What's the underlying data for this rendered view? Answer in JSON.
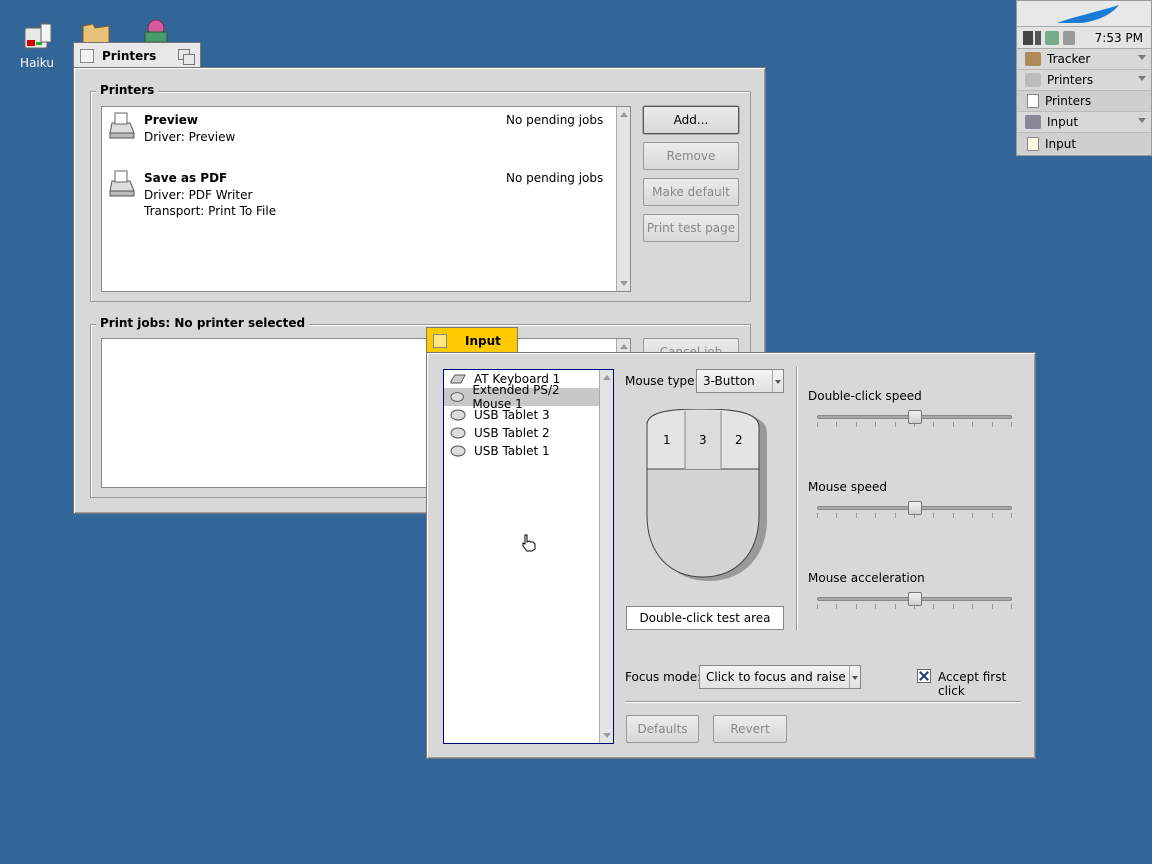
{
  "desktop": {
    "icons": [
      {
        "label": "Haiku"
      }
    ]
  },
  "deskbar": {
    "clock": "7:53 PM",
    "items": [
      {
        "label": "Tracker",
        "kind": "app"
      },
      {
        "label": "Printers",
        "kind": "app"
      },
      {
        "label": "Printers",
        "kind": "window"
      },
      {
        "label": "Input",
        "kind": "app"
      },
      {
        "label": "Input",
        "kind": "window"
      }
    ]
  },
  "printers_window": {
    "title": "Printers",
    "printers_group_label": "Printers",
    "printers": [
      {
        "name": "Preview",
        "driver": "Driver: Preview",
        "transport": "",
        "status": "No pending jobs"
      },
      {
        "name": "Save as PDF",
        "driver": "Driver: PDF Writer",
        "transport": "Transport: Print To File",
        "status": "No pending jobs"
      }
    ],
    "buttons": {
      "add": "Add...",
      "remove": "Remove",
      "make_default": "Make default",
      "print_test_page": "Print test page",
      "cancel_job": "Cancel job"
    },
    "jobs_group_label": "Print jobs: No printer selected"
  },
  "input_window": {
    "title": "Input",
    "devices": [
      {
        "label": "AT Keyboard 1",
        "icon": "keyboard-icon",
        "selected": false
      },
      {
        "label": "Extended PS/2 Mouse 1",
        "icon": "mouse-icon",
        "selected": true
      },
      {
        "label": "USB Tablet 3",
        "icon": "mouse-icon",
        "selected": false
      },
      {
        "label": "USB Tablet 2",
        "icon": "mouse-icon",
        "selected": false
      },
      {
        "label": "USB Tablet 1",
        "icon": "mouse-icon",
        "selected": false
      }
    ],
    "mouse_type_label": "Mouse type:",
    "mouse_type_value": "3-Button",
    "mouse_buttons": [
      "1",
      "3",
      "2"
    ],
    "double_click_test_area": "Double-click test area",
    "sliders": [
      {
        "label": "Double-click speed",
        "value": 0.5
      },
      {
        "label": "Mouse speed",
        "value": 0.5
      },
      {
        "label": "Mouse acceleration",
        "value": 0.5
      }
    ],
    "focus_mode_label": "Focus mode:",
    "focus_mode_value": "Click to focus and raise",
    "accept_first_click_label": "Accept first click",
    "accept_first_click_checked": true,
    "defaults_button": "Defaults",
    "revert_button": "Revert"
  },
  "colors": {
    "desktop": "#336698",
    "active_tab": "#ffcb00",
    "inactive_tab": "#e8e8e8",
    "selection_border": "#000080"
  }
}
